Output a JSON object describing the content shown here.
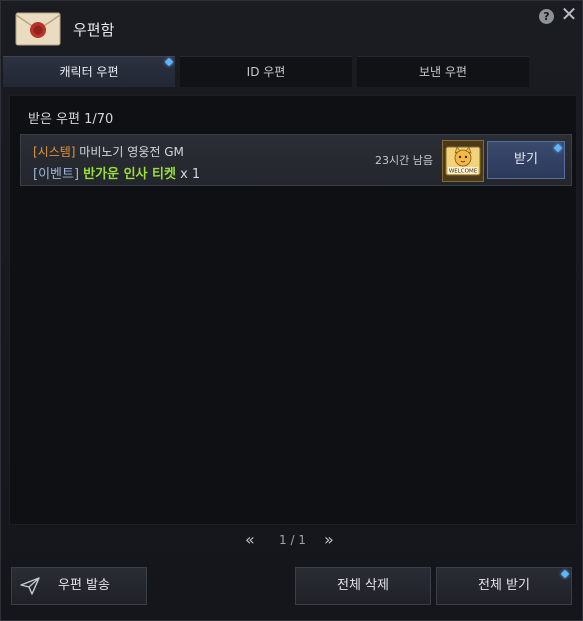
{
  "window": {
    "title": "우편함"
  },
  "header": {
    "help_label": "?",
    "close_label": "✕"
  },
  "tabs": [
    {
      "label": "캐릭터 우편",
      "active": true,
      "has_notice": true
    },
    {
      "label": "ID 우편",
      "active": false
    },
    {
      "label": "보낸 우편",
      "active": false
    }
  ],
  "inbox": {
    "count_label": "받은 우편 1/70",
    "mails": [
      {
        "sender_tag": "[시스템]",
        "sender_name": " 마비노기 영웅전 GM",
        "subject_tag": "[이벤트]",
        "subject_item": "반가운 인사 티켓",
        "subject_qty": " x 1",
        "time_left": "23시간 남음",
        "item_icon": "welcome-cat-ticket-icon",
        "item_icon_text": "WELCOME",
        "receive_label": "받기"
      }
    ]
  },
  "pagination": {
    "prev": "«",
    "page": "1 / 1",
    "next": "»"
  },
  "footer": {
    "send_label": "우편 발송",
    "delete_all_label": "전체 삭제",
    "receive_all_label": "전체 받기"
  },
  "colors": {
    "accent_blue": "#5fb6ff",
    "system_tag": "#e0933c",
    "event_tag": "#9bb6d8",
    "item_name": "#9ade3a"
  }
}
